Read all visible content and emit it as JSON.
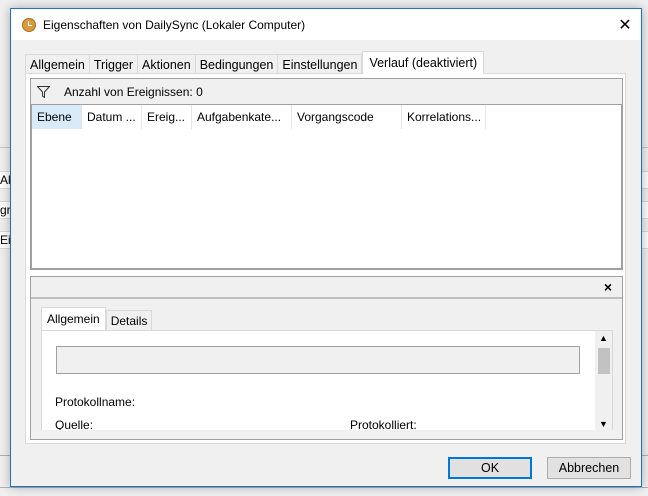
{
  "window": {
    "title": "Eigenschaften von DailySync (Lokaler Computer)"
  },
  "tabs": [
    {
      "label": "Allgemein"
    },
    {
      "label": "Trigger"
    },
    {
      "label": "Aktionen"
    },
    {
      "label": "Bedingungen"
    },
    {
      "label": "Einstellungen"
    },
    {
      "label": "Verlauf (deaktiviert)",
      "active": true
    }
  ],
  "filter": {
    "text": "Anzahl von Ereignissen: 0"
  },
  "columns": [
    {
      "label": "Ebene",
      "sorted": true
    },
    {
      "label": "Datum ..."
    },
    {
      "label": "Ereig..."
    },
    {
      "label": "Aufgabenkate..."
    },
    {
      "label": "Vorgangscode"
    },
    {
      "label": "Korrelations..."
    }
  ],
  "detail": {
    "close": "×",
    "tabs": [
      {
        "label": "Allgemein",
        "active": true
      },
      {
        "label": "Details"
      }
    ],
    "labels": {
      "protokollname": "Protokollname:",
      "quelle": "Quelle:",
      "protokolliert": "Protokolliert:"
    }
  },
  "buttons": {
    "ok": "OK",
    "cancel": "Abbrechen"
  },
  "background": {
    "frag1": "Ak",
    "frag2": "gr",
    "frag3": "Ei"
  },
  "icons": {
    "close": "close-icon",
    "filter": "filter-icon",
    "clock": "clock-icon"
  }
}
